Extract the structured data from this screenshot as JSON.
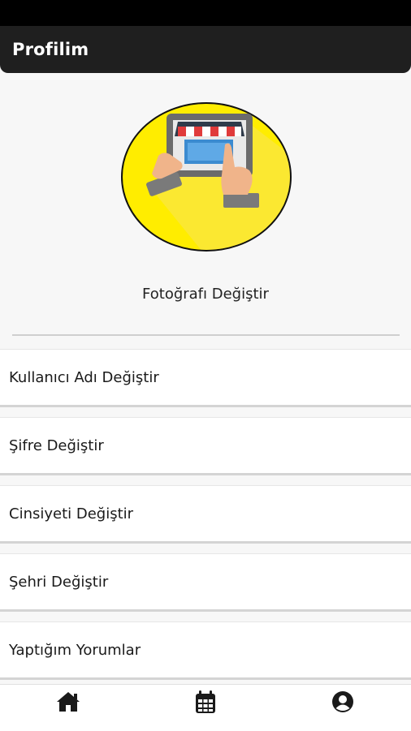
{
  "app_bar": {
    "title": "Profilim"
  },
  "profile": {
    "avatar_icon": "online-shop-icon",
    "change_photo_label": "Fotoğrafı Değiştir"
  },
  "menu": {
    "items": [
      {
        "label": "Kullanıcı Adı Değiştir"
      },
      {
        "label": "Şifre Değiştir"
      },
      {
        "label": "Cinsiyeti Değiştir"
      },
      {
        "label": "Şehri Değiştir"
      },
      {
        "label": "Yaptığım Yorumlar"
      }
    ]
  },
  "bottom_nav": {
    "items": [
      {
        "icon": "home-icon"
      },
      {
        "icon": "calendar-icon"
      },
      {
        "icon": "user-circle-icon"
      }
    ]
  },
  "colors": {
    "app_bar": "#1f1f1f",
    "avatar_background": "#ffed00",
    "background": "#f7f7f7"
  }
}
